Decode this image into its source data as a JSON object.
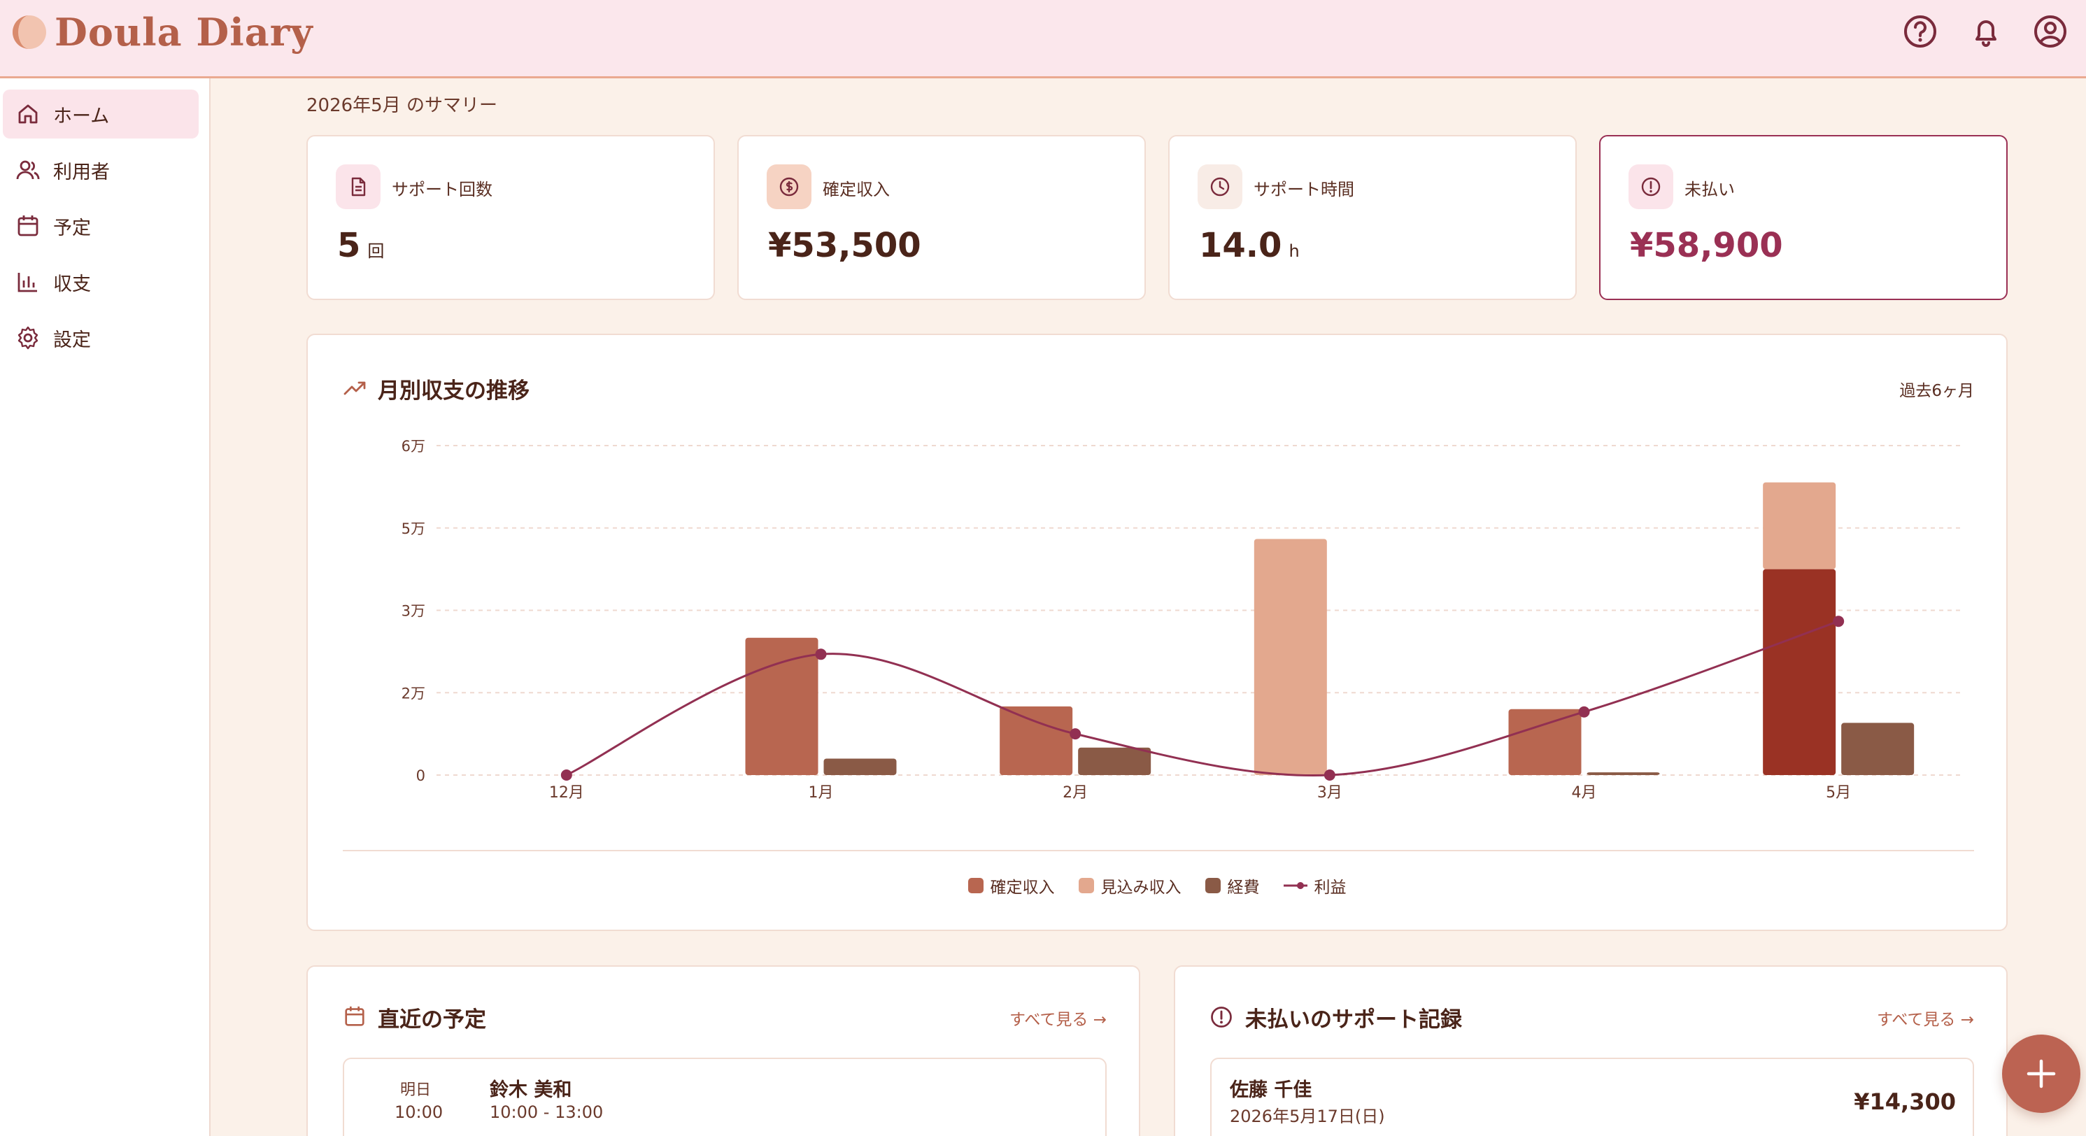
{
  "app": {
    "title": "Doula Diary"
  },
  "header": {
    "icons": [
      "help-icon",
      "bell-icon",
      "account-icon"
    ]
  },
  "sidebar": {
    "items": [
      {
        "label": "ホーム",
        "icon": "home-icon",
        "active": true
      },
      {
        "label": "利用者",
        "icon": "users-icon",
        "active": false
      },
      {
        "label": "予定",
        "icon": "calendar-icon",
        "active": false
      },
      {
        "label": "収支",
        "icon": "bar-chart-icon",
        "active": false
      },
      {
        "label": "設定",
        "icon": "gear-icon",
        "active": false
      }
    ]
  },
  "summary": {
    "title": "2026年5月 のサマリー",
    "cards": [
      {
        "label": "サポート回数",
        "value": "5",
        "unit": "回",
        "icon": "document-icon"
      },
      {
        "label": "確定収入",
        "value": "¥53,500",
        "unit": "",
        "icon": "dollar-icon"
      },
      {
        "label": "サポート時間",
        "value": "14.0",
        "unit": "h",
        "icon": "clock-icon"
      },
      {
        "label": "未払い",
        "value": "¥58,900",
        "unit": "",
        "icon": "alert-icon"
      }
    ]
  },
  "chart_card": {
    "title": "月別収支の推移",
    "range": "過去6ヶ月"
  },
  "chart_data": {
    "type": "bar",
    "categories": [
      "12月",
      "1月",
      "2月",
      "3月",
      "4月",
      "5月"
    ],
    "y_ticks": [
      "0",
      "2万",
      "3万",
      "5万",
      "6万"
    ],
    "ylim": [
      0,
      60000
    ],
    "series": [
      {
        "name": "確定収入",
        "values": [
          0,
          25000,
          12500,
          0,
          12000,
          37500
        ],
        "color": "#b86650"
      },
      {
        "name": "見込み収入",
        "values": [
          0,
          0,
          0,
          43000,
          0,
          15800
        ],
        "color": "#e3a88e"
      },
      {
        "name": "経費",
        "values": [
          0,
          3000,
          5000,
          0,
          500,
          9500
        ],
        "color": "#8a5a46"
      },
      {
        "name": "利益",
        "values": [
          0,
          22000,
          7500,
          0,
          11500,
          28000
        ],
        "color": "#923052"
      }
    ],
    "stacked_series": [
      "確定収入",
      "見込み収入"
    ],
    "legend_position": "bottom",
    "grid": true
  },
  "schedule_card": {
    "title": "直近の予定",
    "link": "すべて見る →",
    "items": [
      {
        "day": "明日",
        "time": "10:00",
        "name": "鈴木 美和",
        "range": "10:00 - 13:00"
      }
    ]
  },
  "unpaid_card": {
    "title": "未払いのサポート記録",
    "link": "すべて見る →",
    "items": [
      {
        "name": "佐藤 千佳",
        "date": "2026年5月17日(日)",
        "amount": "¥14,300"
      }
    ]
  },
  "fab": {
    "label": "+"
  }
}
